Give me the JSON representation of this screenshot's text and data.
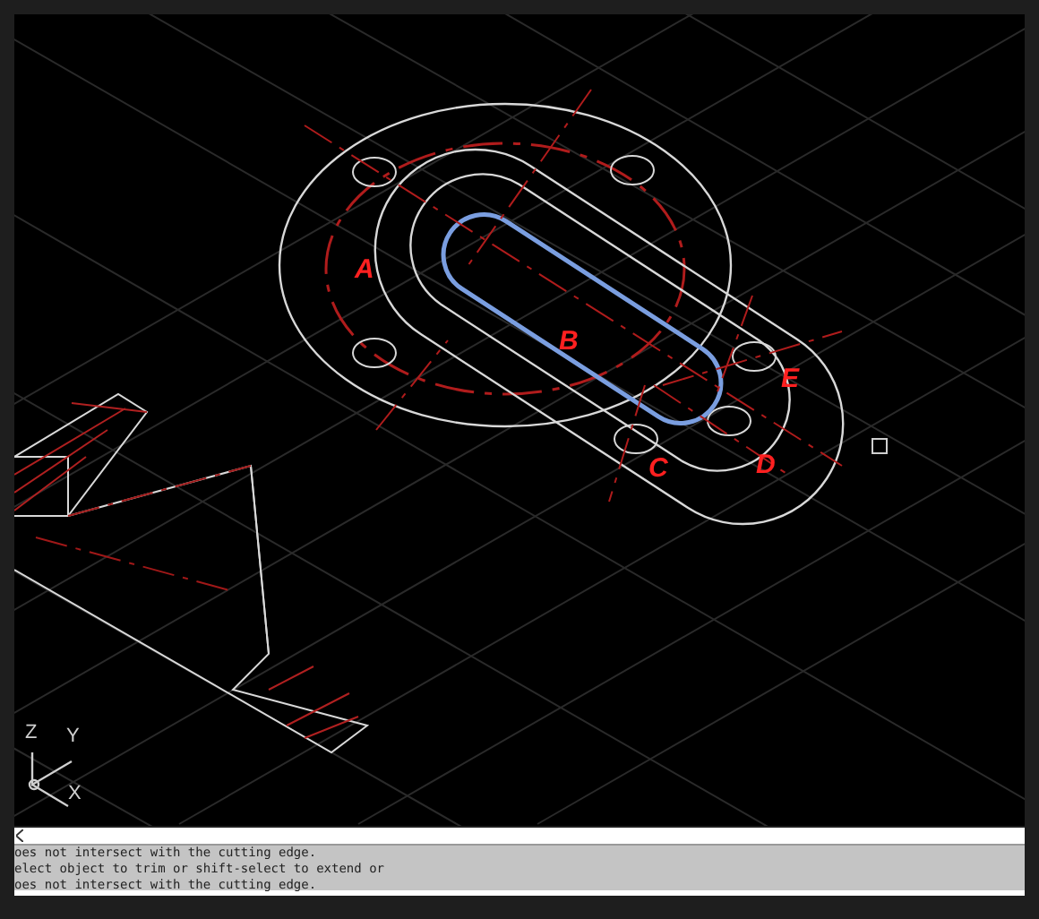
{
  "drawing_labels": [
    {
      "text": "A"
    },
    {
      "text": "B"
    },
    {
      "text": "E"
    },
    {
      "text": "C"
    },
    {
      "text": "D"
    }
  ],
  "ucs_icon": {
    "axes": [
      "Z",
      "Y",
      "X"
    ]
  },
  "command_line": {
    "history": [
      "oes not intersect with the cutting edge.",
      "elect object to trim or shift-select to extend or",
      "oes not intersect with the cutting edge."
    ]
  }
}
